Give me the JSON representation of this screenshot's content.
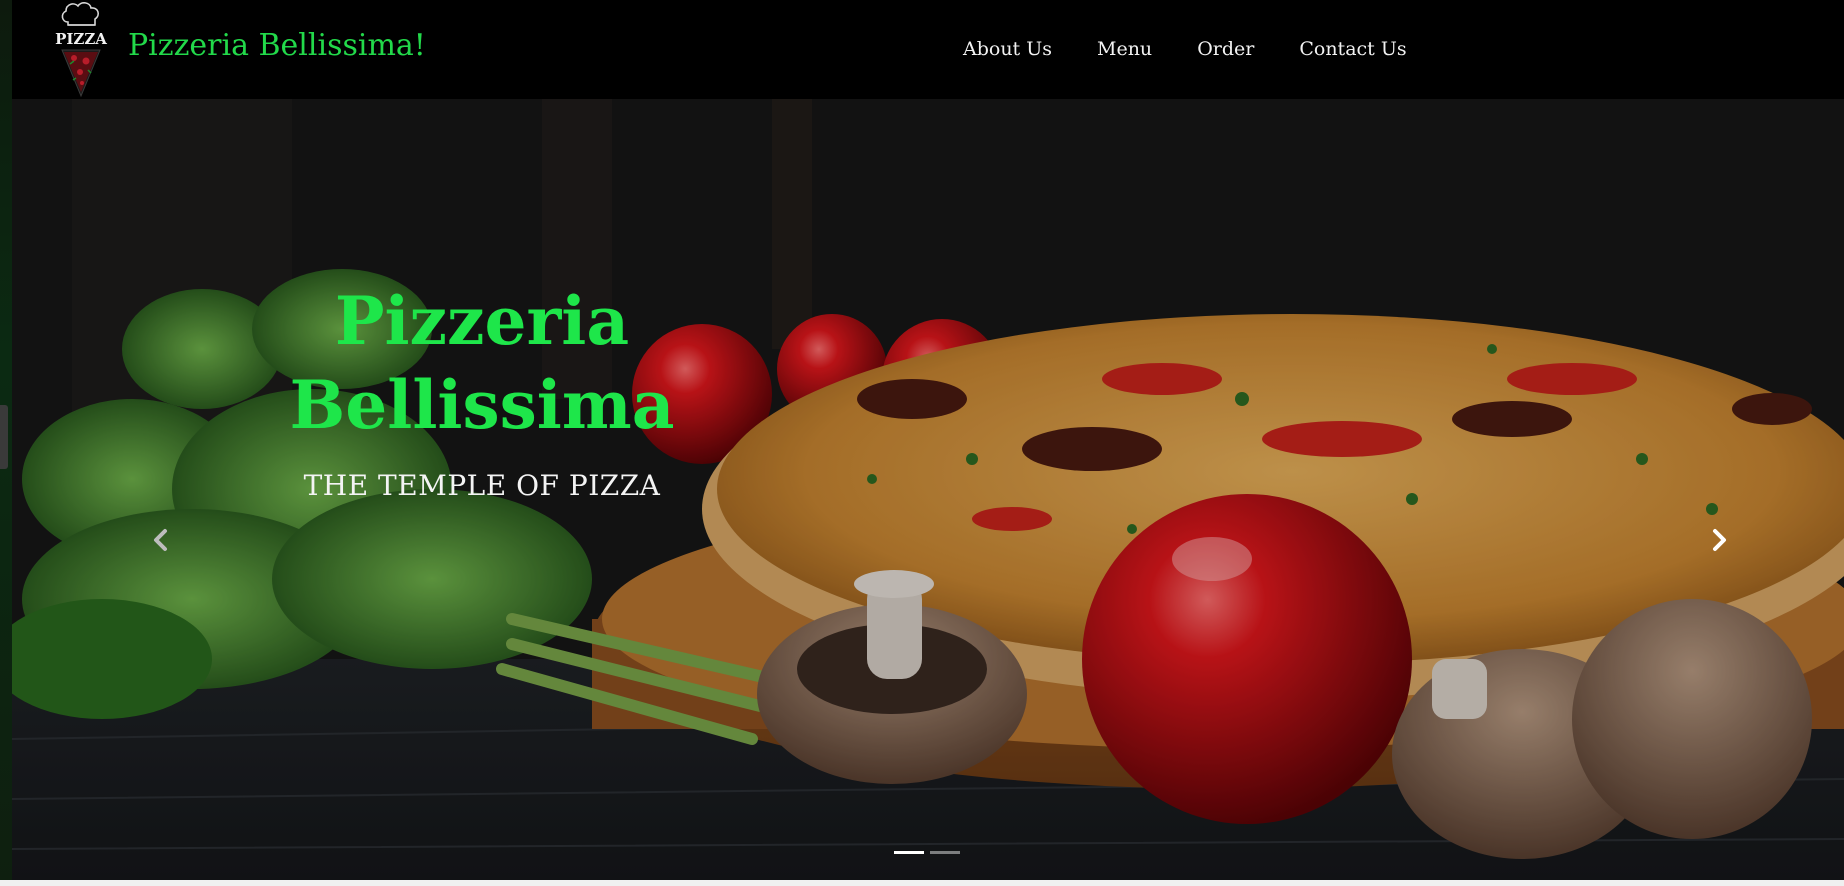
{
  "navbar": {
    "logo_text": "PIZZA",
    "brand_title": "Pizzeria Bellissima!",
    "links": [
      {
        "label": "About Us"
      },
      {
        "label": "Menu"
      },
      {
        "label": "Order"
      },
      {
        "label": "Contact Us"
      }
    ]
  },
  "hero": {
    "title_line1": "Pizzeria",
    "title_line2": "Bellissima",
    "subtitle": "THE TEMPLE OF PIZZA",
    "prev_icon": "chevron-left-icon",
    "next_icon": "chevron-right-icon",
    "slide_count": 2,
    "active_slide": 1
  },
  "colors": {
    "brand_green": "#22d94a",
    "hero_title_green": "#1ee64a",
    "navbar_bg": "#000000",
    "text_light": "#f2f2f2"
  }
}
